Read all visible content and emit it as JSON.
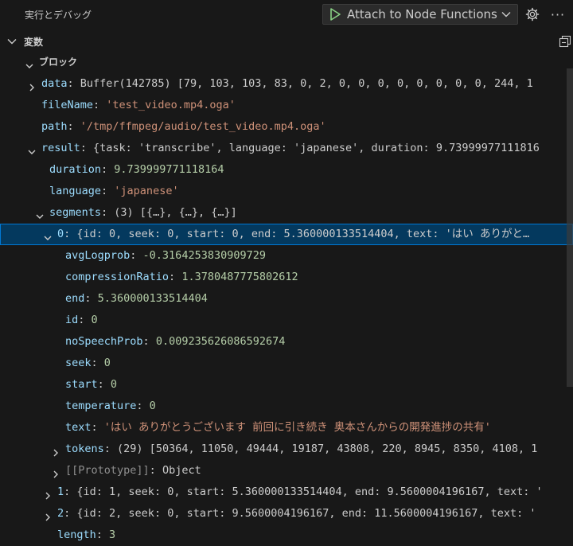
{
  "header": {
    "title": "実行とデバッグ",
    "launch_config": "Attach to Node Functions",
    "play_icon": "play-icon",
    "gear_icon": "gear-icon",
    "more_icon": "more-icon"
  },
  "section": {
    "label": "変数"
  },
  "tree": [
    {
      "indent": 31,
      "twisty": "expanded",
      "scope": true,
      "key": "ブロック"
    },
    {
      "indent": 34,
      "twisty": "collapsed",
      "key": "data",
      "sep": ": ",
      "value": "Buffer(142785) [79, 103, 103, 83, 0, 2, 0, 0, 0, 0, 0, 0, 0, 0, 244, 1",
      "vtype": "plain"
    },
    {
      "indent": 52,
      "twisty": "none",
      "key": "fileName",
      "sep": ": ",
      "value": "'test_video.mp4.oga'",
      "vtype": "str"
    },
    {
      "indent": 52,
      "twisty": "none",
      "key": "path",
      "sep": ": ",
      "value": "'/tmp/ffmpeg/audio/test_video.mp4.oga'",
      "vtype": "str"
    },
    {
      "indent": 34,
      "twisty": "expanded",
      "key": "result",
      "sep": ": ",
      "value": "{task: 'transcribe', language: 'japanese', duration: 9.73999977111816",
      "vtype": "plain"
    },
    {
      "indent": 62,
      "twisty": "none",
      "key": "duration",
      "sep": ": ",
      "value": "9.739999771118164",
      "vtype": "num"
    },
    {
      "indent": 62,
      "twisty": "none",
      "key": "language",
      "sep": ": ",
      "value": "'japanese'",
      "vtype": "str"
    },
    {
      "indent": 44,
      "twisty": "expanded",
      "key": "segments",
      "sep": ": ",
      "value": "(3) [{…}, {…}, {…}]",
      "vtype": "plain"
    },
    {
      "indent": 54,
      "twisty": "expanded",
      "selected": true,
      "key": "0",
      "sep": ": ",
      "value": "{id: 0, seek: 0, start: 0, end: 5.360000133514404, text: 'はい ありがと…",
      "vtype": "plain"
    },
    {
      "indent": 82,
      "twisty": "none",
      "key": "avgLogprob",
      "sep": ": ",
      "value": "-0.3164253830909729",
      "vtype": "num"
    },
    {
      "indent": 82,
      "twisty": "none",
      "key": "compressionRatio",
      "sep": ": ",
      "value": "1.3780487775802612",
      "vtype": "num"
    },
    {
      "indent": 82,
      "twisty": "none",
      "key": "end",
      "sep": ": ",
      "value": "5.360000133514404",
      "vtype": "num"
    },
    {
      "indent": 82,
      "twisty": "none",
      "key": "id",
      "sep": ": ",
      "value": "0",
      "vtype": "num"
    },
    {
      "indent": 82,
      "twisty": "none",
      "key": "noSpeechProb",
      "sep": ": ",
      "value": "0.009235626086592674",
      "vtype": "num"
    },
    {
      "indent": 82,
      "twisty": "none",
      "key": "seek",
      "sep": ": ",
      "value": "0",
      "vtype": "num"
    },
    {
      "indent": 82,
      "twisty": "none",
      "key": "start",
      "sep": ": ",
      "value": "0",
      "vtype": "num"
    },
    {
      "indent": 82,
      "twisty": "none",
      "key": "temperature",
      "sep": ": ",
      "value": "0",
      "vtype": "num"
    },
    {
      "indent": 82,
      "twisty": "none",
      "key": "text",
      "sep": ": ",
      "value": "'はい ありがとうございます 前回に引き続き 奥本さんからの開発進捗の共有'",
      "vtype": "str"
    },
    {
      "indent": 64,
      "twisty": "collapsed",
      "key": "tokens",
      "sep": ": ",
      "value": "(29) [50364, 11050, 49444, 19187, 43808, 220, 8945, 8350, 4108, 1",
      "vtype": "plain"
    },
    {
      "indent": 64,
      "twisty": "collapsed",
      "proto": true,
      "key": "[[Prototype]]",
      "sep": ": ",
      "value": "Object",
      "vtype": "plain"
    },
    {
      "indent": 54,
      "twisty": "collapsed",
      "key": "1",
      "sep": ": ",
      "value": "{id: 1, seek: 0, start: 5.360000133514404, end: 9.5600004196167, text: '",
      "vtype": "plain"
    },
    {
      "indent": 54,
      "twisty": "collapsed",
      "key": "2",
      "sep": ": ",
      "value": "{id: 2, seek: 0, start: 9.5600004196167, end: 11.5600004196167, text: '",
      "vtype": "plain"
    },
    {
      "indent": 72,
      "twisty": "none",
      "key": "length",
      "sep": ": ",
      "value": "3",
      "vtype": "num"
    }
  ]
}
